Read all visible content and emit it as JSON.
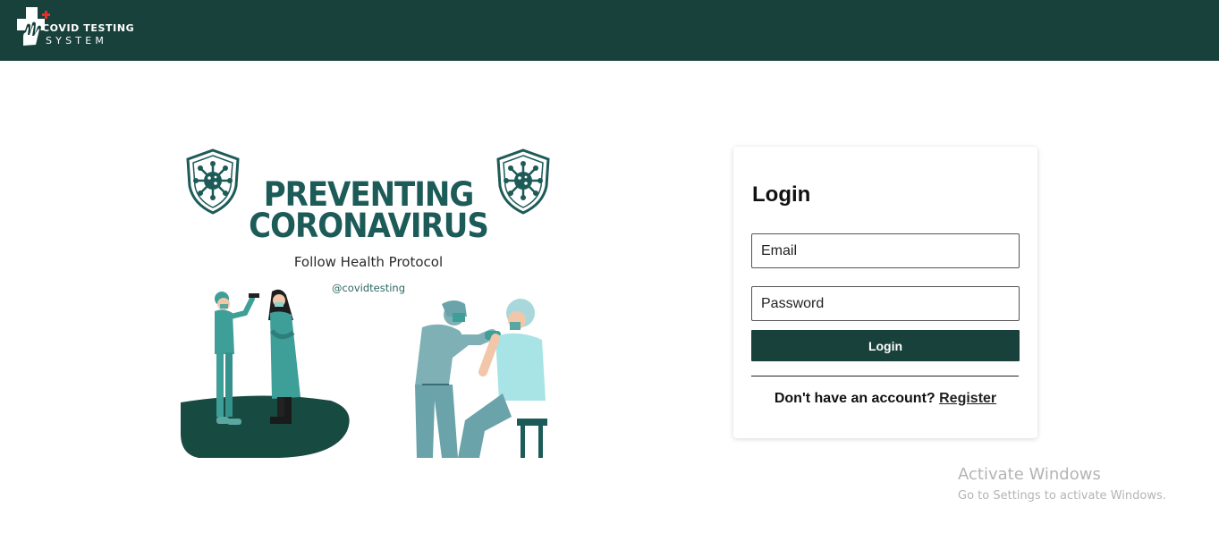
{
  "header": {
    "logo_line1": "COVID TESTING",
    "logo_line2": "SYSTEM",
    "background_color": "#18413c"
  },
  "poster": {
    "title_line1": "PREVENTING",
    "title_line2": "CORONAVIRUS",
    "subtitle": "Follow Health Protocol",
    "handle": "@covidtesting",
    "accent_color": "#1c5b58",
    "icons": [
      "virus-shield-icon",
      "virus-shield-icon"
    ]
  },
  "login": {
    "title": "Login",
    "email_placeholder": "Email",
    "password_placeholder": "Password",
    "button_label": "Login",
    "no_account_text": "Don't have an account?",
    "register_link": "Register",
    "button_color": "#18413c"
  },
  "watermark": {
    "line1": "Activate Windows",
    "line2": "Go to Settings to activate Windows."
  }
}
